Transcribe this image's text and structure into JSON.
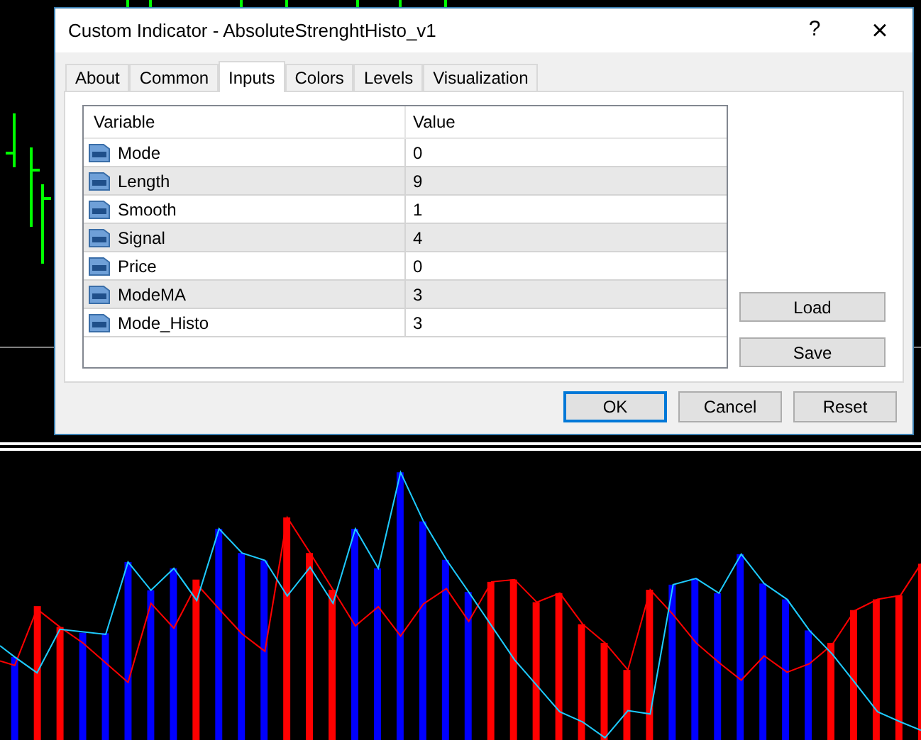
{
  "window": {
    "title": "Custom Indicator - AbsoluteStrenghtHisto_v1",
    "help": "?",
    "close": "×"
  },
  "tabs": [
    {
      "label": "About",
      "selected": false
    },
    {
      "label": "Common",
      "selected": false
    },
    {
      "label": "Inputs",
      "selected": true
    },
    {
      "label": "Colors",
      "selected": false
    },
    {
      "label": "Levels",
      "selected": false
    },
    {
      "label": "Visualization",
      "selected": false
    }
  ],
  "table": {
    "columns": [
      "Variable",
      "Value"
    ],
    "rows": [
      {
        "name": "Mode",
        "value": "0"
      },
      {
        "name": "Length",
        "value": "9"
      },
      {
        "name": "Smooth",
        "value": "1"
      },
      {
        "name": "Signal",
        "value": "4"
      },
      {
        "name": "Price",
        "value": "0"
      },
      {
        "name": "ModeMA",
        "value": "3"
      },
      {
        "name": "Mode_Histo",
        "value": "3"
      }
    ]
  },
  "side_buttons": [
    "Load",
    "Save"
  ],
  "buttons": [
    {
      "label": "OK",
      "default": true
    },
    {
      "label": "Cancel",
      "default": false
    },
    {
      "label": "Reset",
      "default": false
    }
  ]
}
